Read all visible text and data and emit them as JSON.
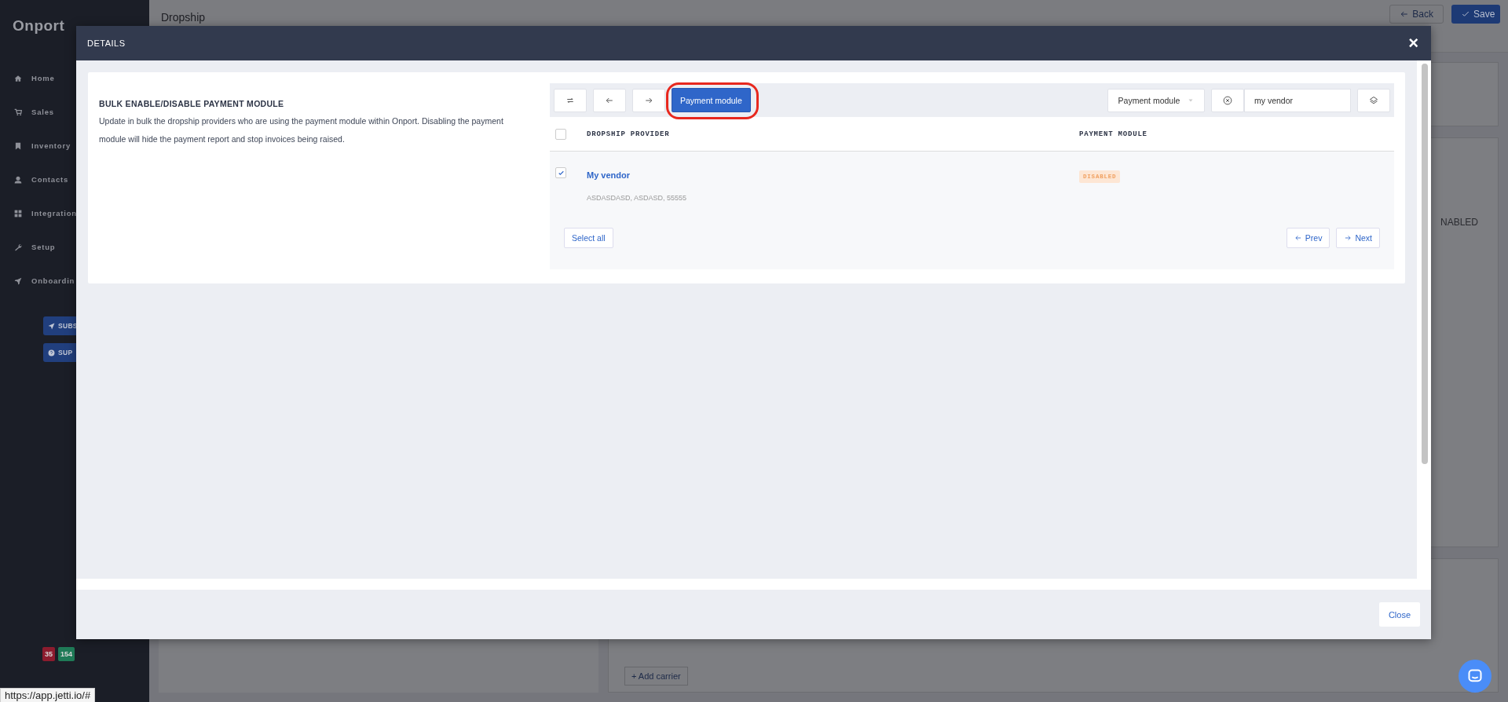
{
  "app": {
    "logo": "Onport",
    "page_title": "Dropship",
    "nav": [
      {
        "label": "Home"
      },
      {
        "label": "Sales"
      },
      {
        "label": "Inventory"
      },
      {
        "label": "Contacts"
      },
      {
        "label": "Integration"
      },
      {
        "label": "Setup"
      },
      {
        "label": "Onboardin"
      }
    ],
    "sidebar_buttons": [
      {
        "label": "SUBS"
      },
      {
        "label": "SUP"
      }
    ],
    "badges": [
      {
        "text": "35",
        "color": "#8c1c2e"
      },
      {
        "text": "154",
        "color": "#1f7a57"
      }
    ],
    "header_buttons": [
      {
        "label": "Back",
        "kind": "back"
      },
      {
        "label": "Save",
        "kind": "save"
      }
    ],
    "status_text": "NABLED",
    "add_button": "+ Add carrier"
  },
  "modal": {
    "title": "DETAILS",
    "close": "×",
    "section_title": "BULK ENABLE/DISABLE PAYMENT MODULE",
    "description": "Update in bulk the dropship providers who are using the payment module within Onport. Disabling the payment module will hide the payment report and stop invoices being raised.",
    "toolbar": [
      {
        "kind": "refresh"
      },
      {
        "kind": "prev"
      },
      {
        "kind": "next"
      },
      {
        "kind": "action",
        "label": "Payment module",
        "highlighted": true
      }
    ],
    "filter": {
      "label": "Payment module"
    },
    "search": {
      "value": "my vendor"
    },
    "table": {
      "columns": [
        "DROPSHIP PROVIDER",
        "PAYMENT MODULE"
      ],
      "all_checked": false,
      "rows": [
        {
          "name": "My vendor",
          "address": "ASDASDASD, ASDASD, 55555",
          "status": "DISABLED",
          "checked": true
        }
      ]
    },
    "select_all": "Select all",
    "prev": "Prev",
    "next": "Next",
    "close_button": "Close"
  },
  "status_url": "https://app.jetti.io/#"
}
